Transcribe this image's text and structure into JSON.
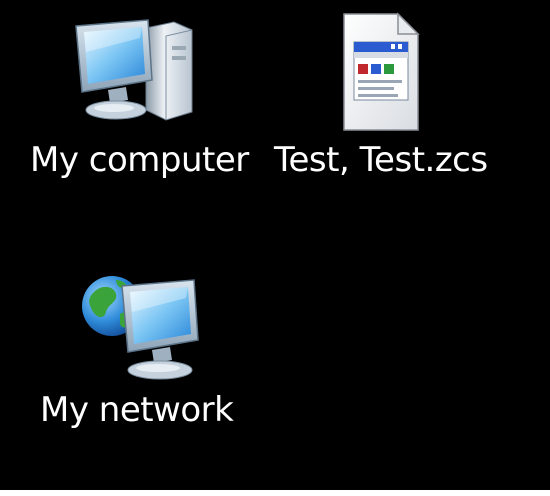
{
  "desktop": {
    "background_color": "#000000",
    "label_color": "#ffffff",
    "icons": [
      {
        "label": "My computer",
        "icon": "computer-icon"
      },
      {
        "label": "Test, Test.zcs",
        "icon": "document-file-icon"
      },
      {
        "label": "My network",
        "icon": "network-globe-icon"
      }
    ]
  }
}
